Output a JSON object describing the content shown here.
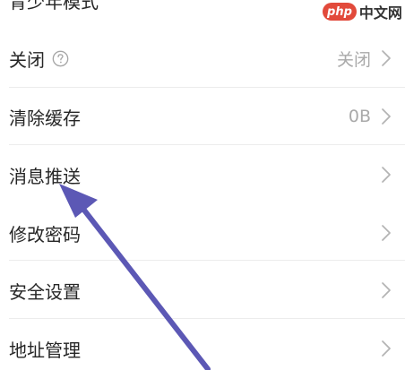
{
  "watermark": {
    "logo": "php",
    "text": "中文网"
  },
  "settings": {
    "items": [
      {
        "label": "青少年模式",
        "value": "",
        "has_chevron": false
      },
      {
        "label": "关闭",
        "has_help_icon": true,
        "value": "关闭",
        "has_chevron": true
      },
      {
        "label": "清除缓存",
        "value": "0B",
        "has_chevron": true
      },
      {
        "label": "消息推送",
        "value": "",
        "has_chevron": true
      },
      {
        "label": "修改密码",
        "value": "",
        "has_chevron": true
      },
      {
        "label": "安全设置",
        "value": "",
        "has_chevron": true
      },
      {
        "label": "地址管理",
        "value": "",
        "has_chevron": true
      }
    ]
  },
  "annotation": {
    "arrow_color": "#5c58b5",
    "points_to": "消息推送"
  },
  "colors": {
    "background": "#ffffff",
    "label_text": "#262626",
    "value_text": "#a9a9a9",
    "chevron": "#b3b3b3",
    "divider": "#ececec",
    "watermark_logo": "#e24a3b"
  },
  "icons": {
    "help": "question-circle-icon",
    "chevron": "chevron-right-icon",
    "arrow": "arrow-up-left-annotation"
  }
}
